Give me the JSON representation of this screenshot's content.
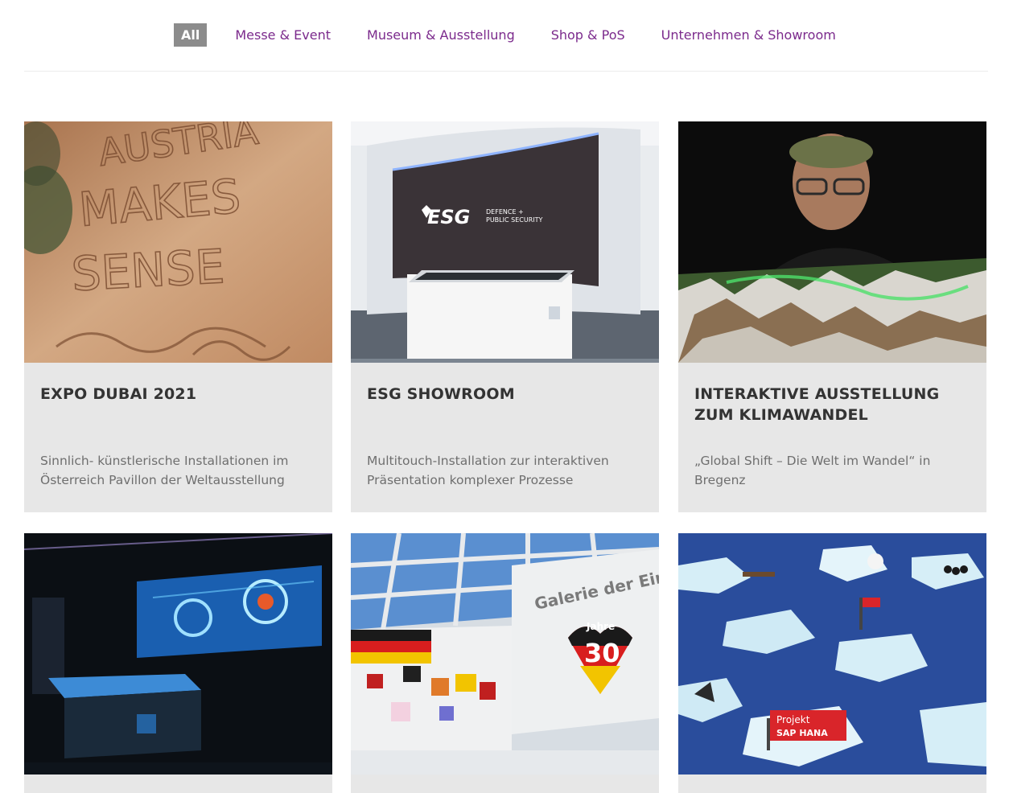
{
  "filters": {
    "all": "All",
    "messe": "Messe & Event",
    "museum": "Museum & Ausstellung",
    "shop": "Shop & PoS",
    "unternehmen": "Unternehmen & Showroom"
  },
  "projects": [
    {
      "title": "EXPO DUBAI 2021",
      "description": "Sinnlich- künstlerische Installationen im Österreich Pavillon der Weltausstellung",
      "image_text": [
        "AUSTRIA",
        "MAKES",
        "SENSE"
      ]
    },
    {
      "title": "ESG SHOWROOM",
      "description": "Multitouch-Installation zur interaktiven Präsentation komplexer Prozesse",
      "image_text": [
        "ESG",
        "DEFENCE +",
        "PUBLIC SECURITY"
      ]
    },
    {
      "title": "INTERAKTIVE AUSSTELLUNG ZUM KLIMAWANDEL",
      "description": "„Global Shift – Die Welt im Wandel“ in Bregenz"
    },
    {
      "title": "",
      "description": ""
    },
    {
      "title": "",
      "description": "",
      "image_text": [
        "Galerie der Einh",
        "Jahre",
        "30"
      ]
    },
    {
      "title": "",
      "description": "",
      "image_text": [
        "Projekt",
        "SAP HANA"
      ]
    }
  ],
  "colors": {
    "accent": "#7b2a8c",
    "active_filter_bg": "#8c8c8c",
    "card_bg": "#e7e7e7"
  }
}
